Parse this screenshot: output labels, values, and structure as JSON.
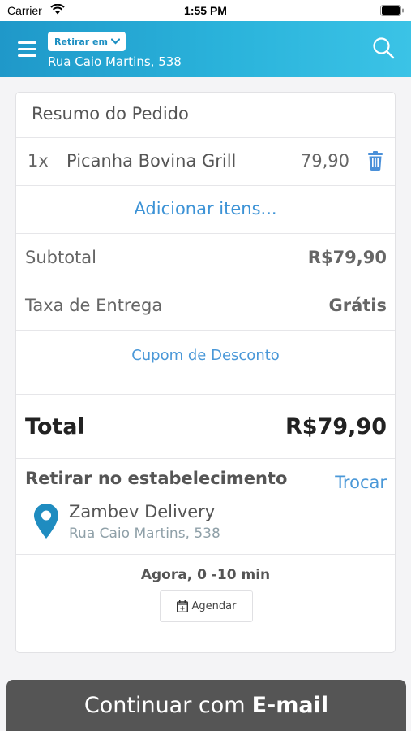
{
  "status_bar": {
    "carrier": "Carrier",
    "time": "1:55 PM"
  },
  "header": {
    "mode_label": "Retirar em",
    "address": "Rua Caio Martins, 538",
    "accent_color": "#2ab3db"
  },
  "order": {
    "title": "Resumo do Pedido",
    "items": [
      {
        "qty": "1x",
        "name": "Picanha Bovina Grill",
        "price": "79,90"
      }
    ],
    "add_items_label": "Adicionar itens...",
    "subtotal_label": "Subtotal",
    "subtotal_value": "R$79,90",
    "delivery_fee_label": "Taxa de Entrega",
    "delivery_fee_value": "Grátis",
    "coupon_label": "Cupom de Desconto",
    "total_label": "Total",
    "total_value": "R$79,90"
  },
  "pickup": {
    "title": "Retirar no estabelecimento",
    "swap_label": "Trocar",
    "store_name": "Zambev Delivery",
    "store_address": "Rua Caio Martins, 538",
    "eta": "Agora, 0 -10 min",
    "schedule_label": "Agendar"
  },
  "footer": {
    "continue_prefix": "Continuar com",
    "continue_method": "E-mail"
  },
  "icons": {
    "menu": "hamburger-icon",
    "search": "search-icon",
    "trash": "trash-icon",
    "pin": "map-pin-icon",
    "calendar": "calendar-plus-icon"
  }
}
